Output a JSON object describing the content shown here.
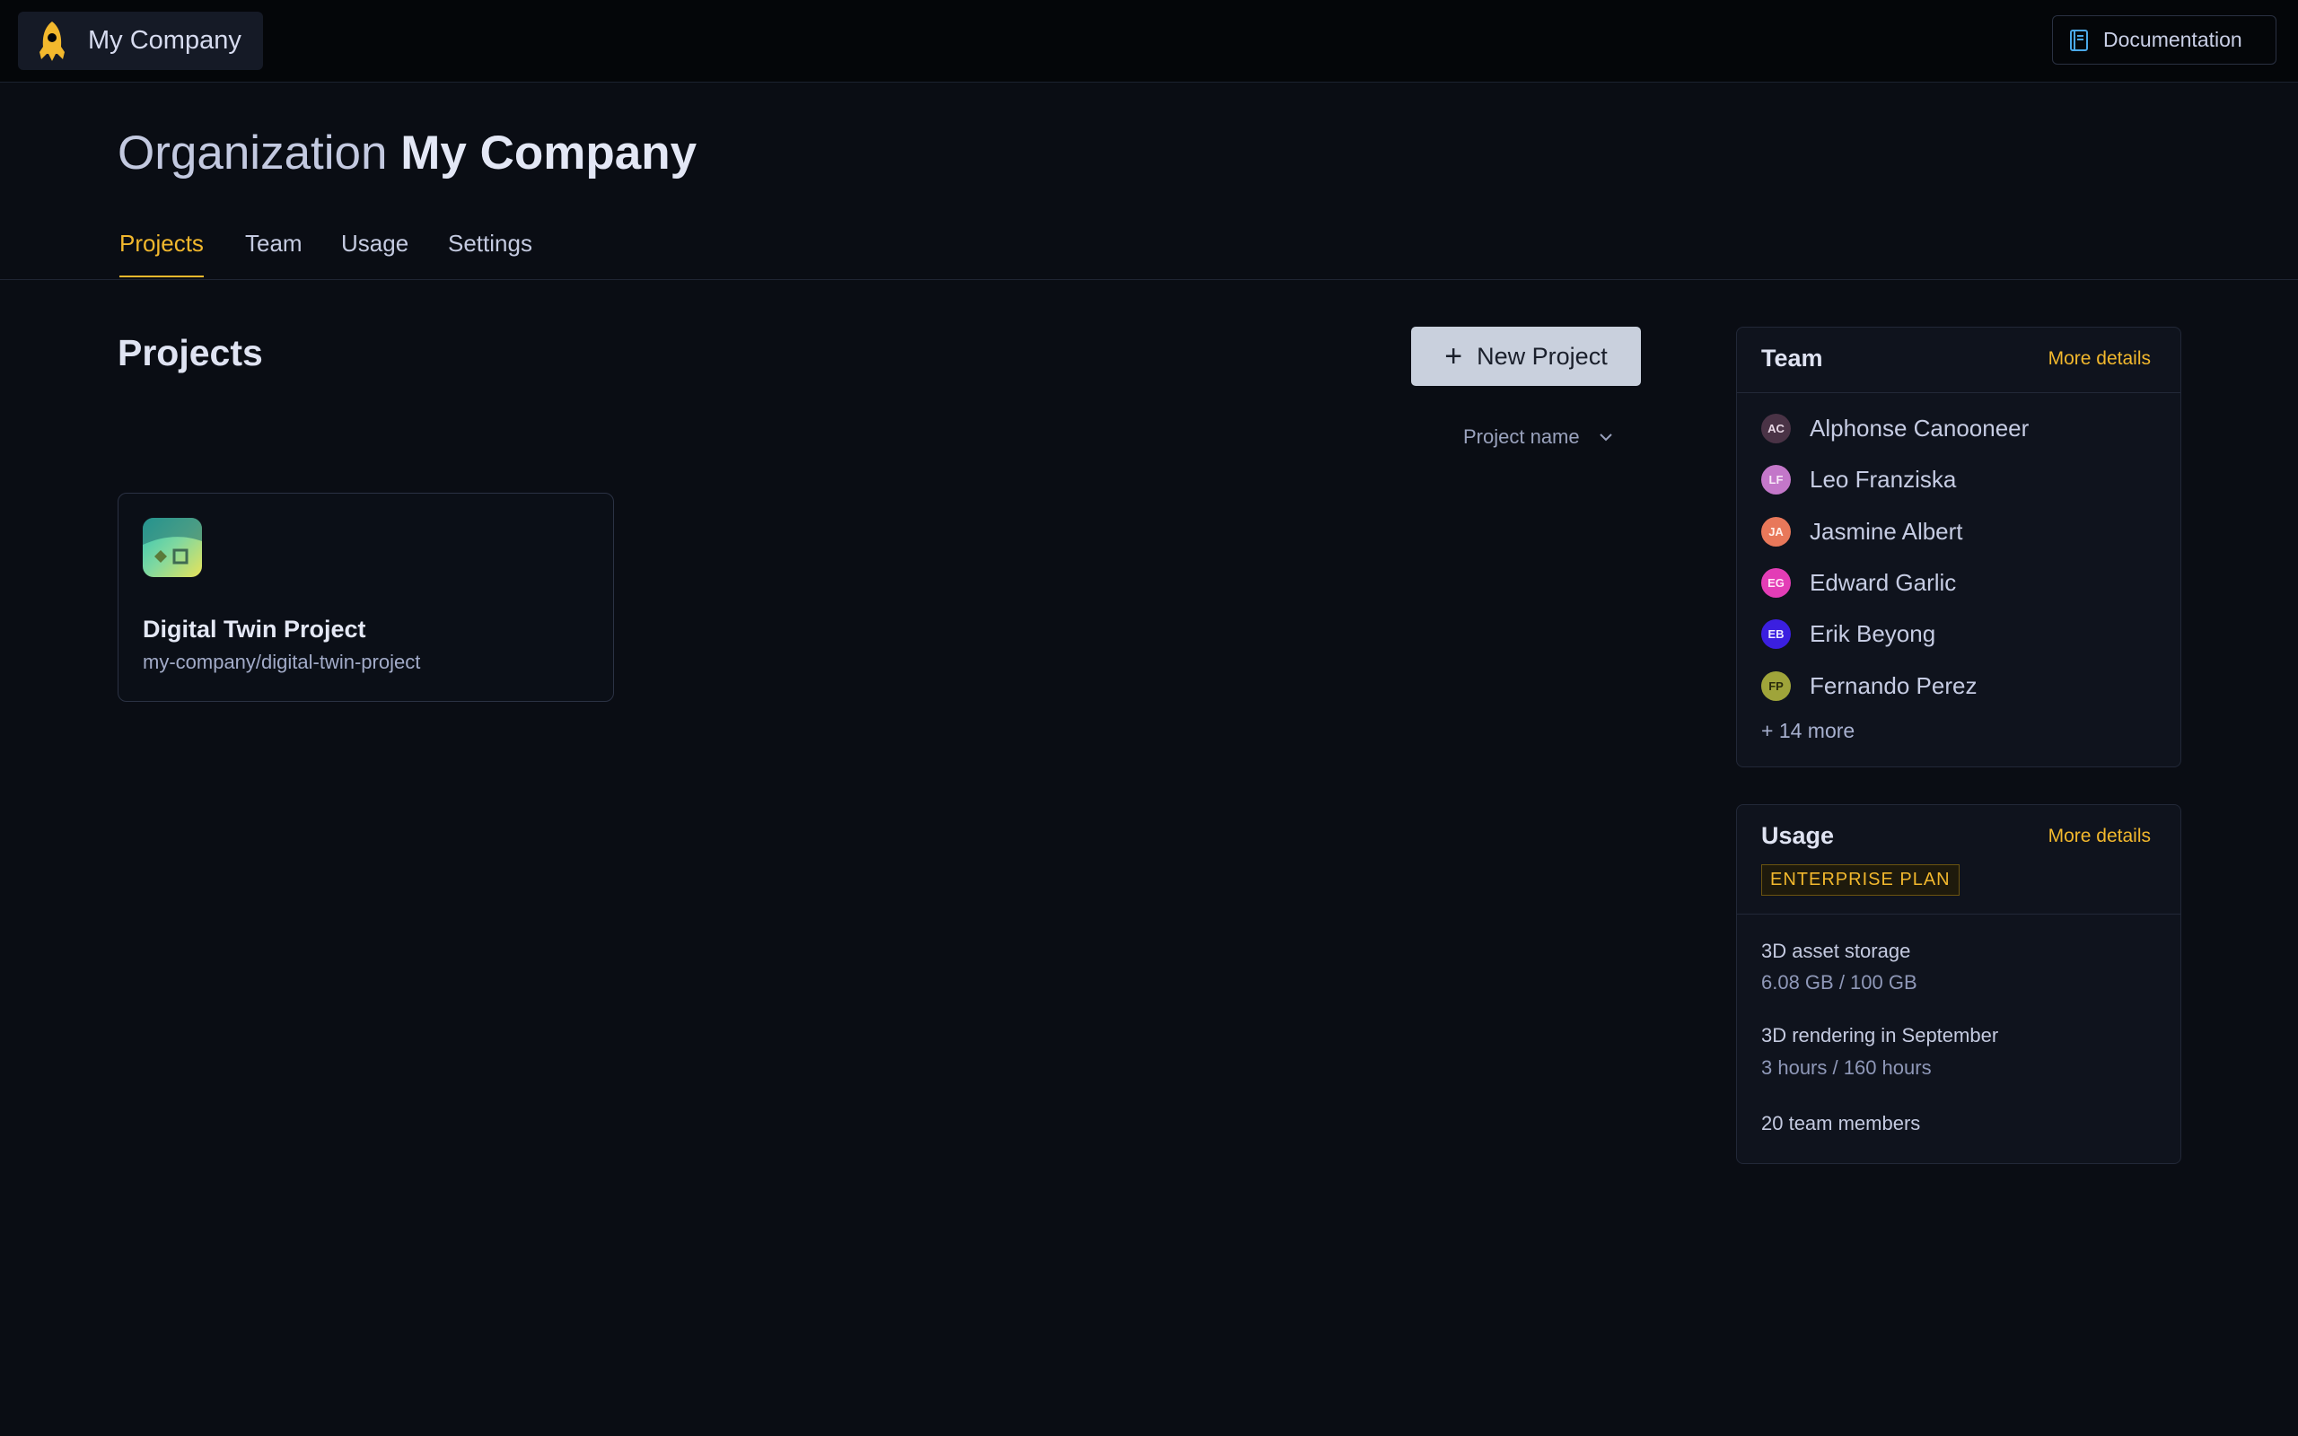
{
  "topbar": {
    "org_name": "My Company",
    "docs_label": "Documentation"
  },
  "header": {
    "prefix": "Organization",
    "org_name": "My Company"
  },
  "tabs": [
    {
      "label": "Projects",
      "active": true
    },
    {
      "label": "Team",
      "active": false
    },
    {
      "label": "Usage",
      "active": false
    },
    {
      "label": "Settings",
      "active": false
    }
  ],
  "projects": {
    "title": "Projects",
    "new_button_label": "New Project",
    "sort_label": "Project name",
    "items": [
      {
        "name": "Digital Twin Project",
        "slug": "my-company/digital-twin-project"
      }
    ]
  },
  "team_panel": {
    "title": "Team",
    "more_label": "More details",
    "members": [
      {
        "initials": "AC",
        "name": "Alphonse Canooneer",
        "color": "#4a3346"
      },
      {
        "initials": "LF",
        "name": "Leo Franziska",
        "color": "#c377c9"
      },
      {
        "initials": "JA",
        "name": "Jasmine Albert",
        "color": "#e8785a"
      },
      {
        "initials": "EG",
        "name": "Edward Garlic",
        "color": "#e33db6"
      },
      {
        "initials": "EB",
        "name": "Erik Beyong",
        "color": "#3b1fe0"
      },
      {
        "initials": "FP",
        "name": "Fernando Perez",
        "color": "#9fa43a"
      }
    ],
    "more_members_label": "+ 14 more"
  },
  "usage_panel": {
    "title": "Usage",
    "more_label": "More details",
    "plan": "ENTERPRISE PLAN",
    "storage_label": "3D asset storage",
    "storage_value": "6.08 GB / 100 GB",
    "rendering_label": "3D rendering in September",
    "rendering_value": "3 hours / 160 hours",
    "members_label": "20 team members"
  },
  "colors": {
    "accent": "#f2b82d",
    "background": "#0a0d14",
    "topbar": "#040609"
  }
}
